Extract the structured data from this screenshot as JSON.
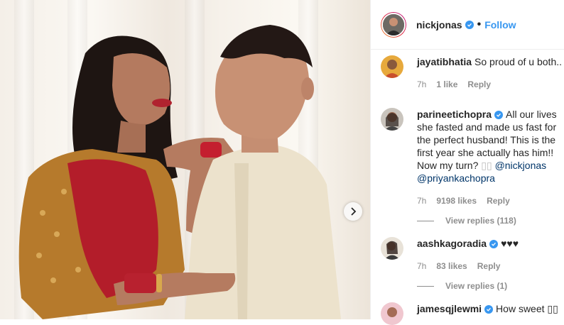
{
  "post": {
    "next_icon": "chevron-right-icon"
  },
  "header": {
    "username": "nickjonas",
    "separator": "•",
    "follow_label": "Follow",
    "verified_icon": "verified-badge-icon"
  },
  "comments": [
    {
      "username": "jayatibhatia",
      "text": "So proud of u both..",
      "time": "7h",
      "likes": "1 like",
      "reply": "Reply"
    },
    {
      "username": "parineetichopra",
      "verified": true,
      "text": "All our lives she fasted and made us fast for the perfect husband! This is the first year she actually has him!! Now my turn?",
      "text_tail": "▯▯",
      "mention1": "@nickjonas",
      "mention2": "@priyankachopra",
      "time": "7h",
      "likes": "9198 likes",
      "reply": "Reply",
      "view_replies": "View replies (118)"
    },
    {
      "username": "aashkagoradia",
      "verified": true,
      "text": "♥♥♥",
      "time": "7h",
      "likes": "83 likes",
      "reply": "Reply",
      "view_replies": "View replies (1)"
    },
    {
      "username": "jamesqjlewmi",
      "verified": true,
      "text": "How sweet ▯▯"
    }
  ],
  "colors": {
    "accent": "#3897f0",
    "text": "#262626",
    "muted": "#8e8e8e",
    "mention": "#003569"
  }
}
